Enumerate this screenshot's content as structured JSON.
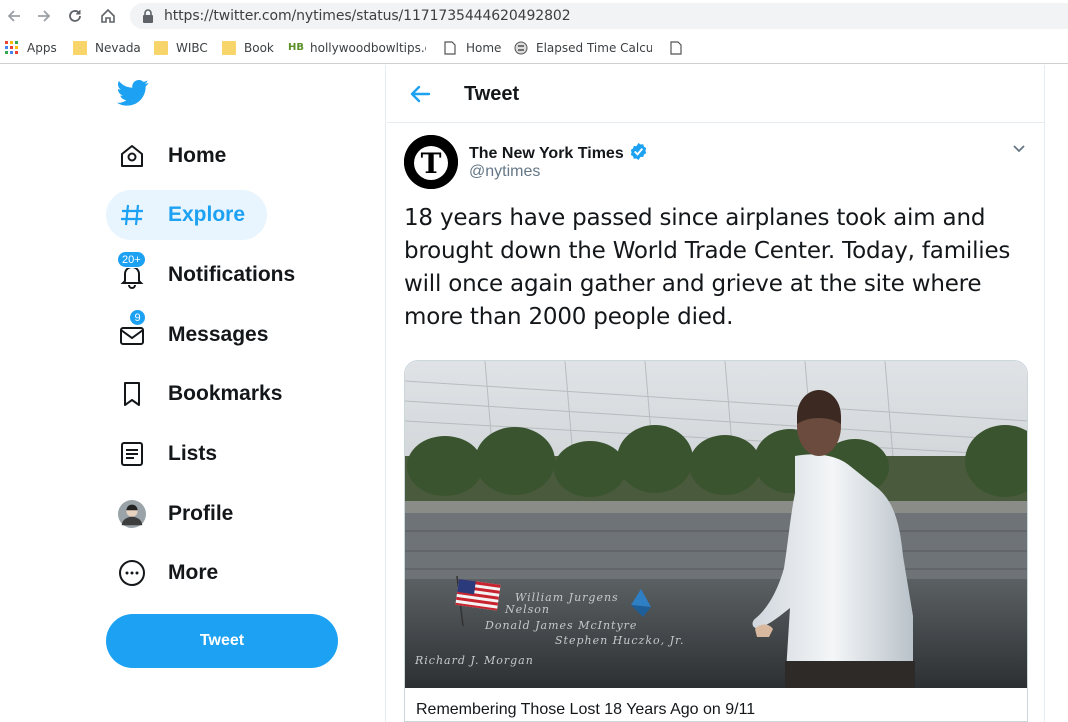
{
  "browser": {
    "url": "https://twitter.com/nytimes/status/1171735444620492802",
    "bookmarks": [
      {
        "label": "Apps",
        "icon": "apps-grid-icon"
      },
      {
        "label": "Nevada",
        "icon": "folder-icon"
      },
      {
        "label": "WIBC",
        "icon": "folder-icon"
      },
      {
        "label": "Book",
        "icon": "folder-icon"
      },
      {
        "label": "hollywoodbowltips.cc",
        "icon": "hb-tips-icon"
      },
      {
        "label": "Home",
        "icon": "page-icon"
      },
      {
        "label": "Elapsed Time Calcula",
        "icon": "calculator-icon"
      },
      {
        "label": "",
        "icon": "page-icon"
      }
    ]
  },
  "nav": {
    "items": [
      {
        "label": "Home",
        "icon": "home-icon"
      },
      {
        "label": "Explore",
        "icon": "hashtag-icon",
        "active": true
      },
      {
        "label": "Notifications",
        "icon": "bell-icon",
        "badge": "20+"
      },
      {
        "label": "Messages",
        "icon": "envelope-icon",
        "badge": "9"
      },
      {
        "label": "Bookmarks",
        "icon": "bookmark-icon"
      },
      {
        "label": "Lists",
        "icon": "list-icon"
      },
      {
        "label": "Profile",
        "icon": "avatar"
      },
      {
        "label": "More",
        "icon": "more-icon"
      }
    ],
    "tweet_button": "Tweet"
  },
  "header": {
    "title": "Tweet"
  },
  "tweet": {
    "author_name": "The New York Times",
    "author_handle": "@nytimes",
    "text": "18 years have passed since airplanes took aim and brought down the World Trade Center. Today, families will once again gather and grieve at the site where more than 2000 people died.",
    "card_title": "Remembering Those Lost 18 Years Ago on 9/11",
    "memorial_names": [
      "William Jurgens",
      "Nelson",
      "Donald James McIntyre",
      "Stephen Huczko, Jr.",
      "Richard J. Morgan"
    ]
  },
  "colors": {
    "accent": "#1da1f2",
    "text": "#14171a",
    "secondary": "#657786"
  }
}
